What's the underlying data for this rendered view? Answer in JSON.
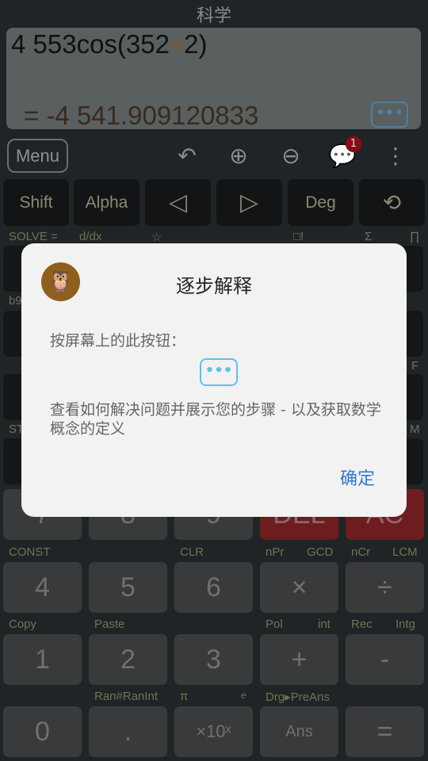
{
  "title": "科学",
  "display": {
    "expression_pre": "4 553cos(352",
    "operator": "÷",
    "expression_post": "2)",
    "result": "= -4 541.909120833",
    "steps_button": "•••"
  },
  "toolbar": {
    "menu": "Menu",
    "undo": "undo-icon",
    "zoom_in": "zoom-in-icon",
    "zoom_out": "zoom-out-icon",
    "chat": "chat-icon",
    "chat_badge": "1",
    "more": "more-icon"
  },
  "top_keys": [
    "Shift",
    "Alpha",
    "◁",
    "▷",
    "Deg",
    "history-icon"
  ],
  "labels_row1": [
    "SOLVE  =",
    "d/dx",
    "☆",
    "□!",
    "Σ",
    "∏"
  ],
  "partial_labels": {
    "row2": "b9",
    "row3": "F",
    "row4_left": "ST",
    "row4_right": "M"
  },
  "row_789": [
    "7",
    "8",
    "9",
    "DEL",
    "AC"
  ],
  "labels_456": [
    "CONST",
    "CLR",
    "nPr",
    "GCD",
    "nCr",
    "LCM"
  ],
  "row_456": [
    "4",
    "5",
    "6",
    "×",
    "÷"
  ],
  "labels_123": [
    "Copy",
    "Paste",
    "Pol",
    "int",
    "Rec",
    "Intg"
  ],
  "row_123": [
    "1",
    "2",
    "3",
    "+",
    "-"
  ],
  "labels_0": [
    "Ran#RanInt",
    "π",
    "e",
    "Drg▸PreAns"
  ],
  "row_0": [
    "0",
    ".",
    "×10ˣ",
    "Ans",
    "="
  ],
  "dialog": {
    "title": "逐步解释",
    "line1": "按屏幕上的此按钮：",
    "button": "•••",
    "line2": "查看如何解决问题并展示您的步骤 - 以及获取数学概念的定义",
    "ok": "确定"
  },
  "colors": {
    "accent": "#2f78d4",
    "steps_button": "#5ec0ea",
    "owl_logo": "#8f5f1e",
    "delete_key": "#6e1c1e"
  }
}
